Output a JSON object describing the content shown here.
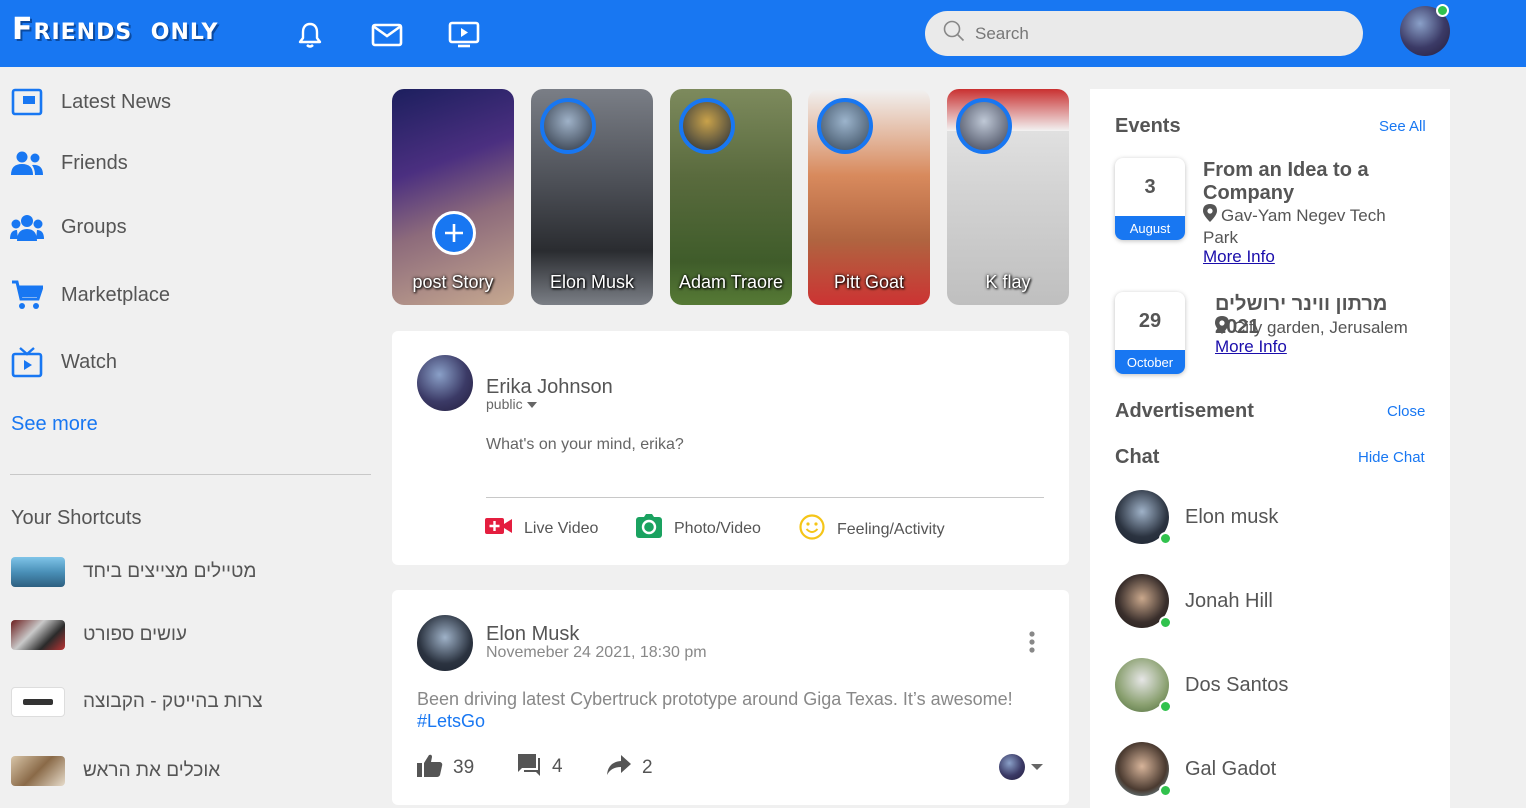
{
  "header": {
    "logo_big": "F",
    "logo_rest": "RIENDS",
    "logo_only": "ONLY",
    "search_placeholder": "Search"
  },
  "sidebar": {
    "items": [
      {
        "label": "Latest News",
        "icon": "news-icon"
      },
      {
        "label": "Friends",
        "icon": "friends-icon"
      },
      {
        "label": "Groups",
        "icon": "groups-icon"
      },
      {
        "label": "Marketplace",
        "icon": "cart-icon"
      },
      {
        "label": "Watch",
        "icon": "tv-icon"
      }
    ],
    "see_more": "See more",
    "shortcuts_title": "Your Shortcuts",
    "shortcuts": [
      {
        "label": "מטיילים מצייצים ביחד"
      },
      {
        "label": "עושים ספורט"
      },
      {
        "label": "צרות בהייטק - הקבוצה"
      },
      {
        "label": "אוכלים את הראש"
      }
    ]
  },
  "stories": [
    {
      "name": "post Story"
    },
    {
      "name": "Elon Musk"
    },
    {
      "name": "Adam Traore"
    },
    {
      "name": "Pitt Goat"
    },
    {
      "name": "K flay"
    }
  ],
  "composer": {
    "user": "Erika Johnson",
    "privacy": "public",
    "placeholder": "What's on your mind, erika?",
    "actions": {
      "live": "Live Video",
      "photo": "Photo/Video",
      "feeling": "Feeling/Activity"
    }
  },
  "post": {
    "author": "Elon Musk",
    "date": "Novemeber 24 2021, 18:30 pm",
    "text": "Been driving latest Cybertruck prototype around Giga Texas. It’s awesome!",
    "hashtag": "#LetsGo",
    "likes": "39",
    "comments": "4",
    "shares": "2"
  },
  "events": {
    "title": "Events",
    "see_all": "See All",
    "items": [
      {
        "day": "3",
        "month": "August",
        "title_1": "From an Idea to a",
        "title_2": "Company",
        "loc_1": "Gav-Yam Negev Tech",
        "loc_2": "Park",
        "more": "More Info"
      },
      {
        "day": "29",
        "month": "October",
        "title_1": "מרתון ווינר ירושלים 2021",
        "loc_1": "City garden, Jerusalem",
        "more": "More Info"
      }
    ]
  },
  "advertisement": {
    "title": "Advertisement",
    "close": "Close"
  },
  "chat": {
    "title": "Chat",
    "hide": "Hide Chat",
    "people": [
      {
        "name": "Elon musk"
      },
      {
        "name": "Jonah Hill"
      },
      {
        "name": "Dos Santos"
      },
      {
        "name": "Gal Gadot"
      }
    ]
  },
  "colors": {
    "accent": "#1877f2",
    "online": "#31c24d",
    "live": "#e41e3f",
    "photo": "#1aa260",
    "feeling": "#f5c518"
  }
}
